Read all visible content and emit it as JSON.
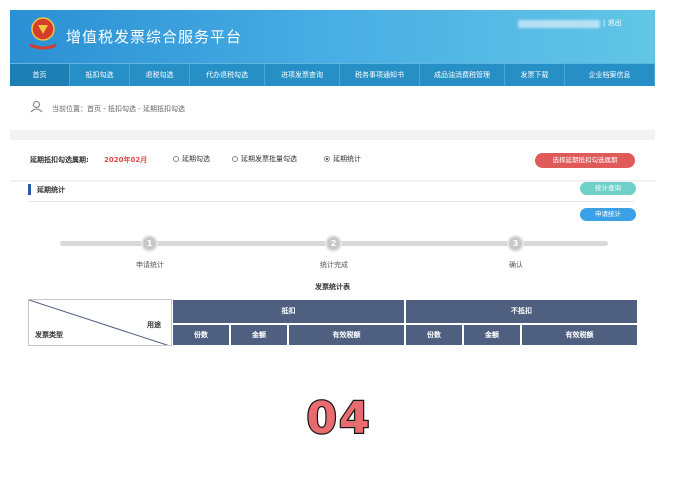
{
  "header": {
    "title": "增值税发票综合服务平台",
    "logout": "| 退出"
  },
  "nav": {
    "items": [
      {
        "label": "首页",
        "active": true
      },
      {
        "label": "抵扣勾选"
      },
      {
        "label": "退税勾选"
      },
      {
        "label": "代办退税勾选"
      },
      {
        "label": "进项发票查询"
      },
      {
        "label": "税务事项通知书"
      },
      {
        "label": "成品油消费税管理"
      },
      {
        "label": "发票下载"
      },
      {
        "label": "企业档案信息"
      }
    ]
  },
  "breadcrumb": "当前位置：首页 - 抵扣勾选 - 延期抵扣勾选",
  "filter": {
    "period_label": "延期抵扣勾选属期:",
    "period_value": "2020年02月",
    "options": [
      {
        "label": "延期勾选",
        "checked": false
      },
      {
        "label": "延期发票批量勾选",
        "checked": false
      },
      {
        "label": "延期统计",
        "checked": true
      }
    ],
    "select_period_button": "选择延期抵扣勾选属期"
  },
  "section": {
    "title": "延期统计",
    "stats_query_button": "统计查询",
    "apply_stats_button": "申请统计"
  },
  "steps": [
    {
      "number": "1",
      "label": "申请统计"
    },
    {
      "number": "2",
      "label": "统计完成"
    },
    {
      "number": "3",
      "label": "确认"
    }
  ],
  "table": {
    "title": "发票统计表",
    "corner_type": "发票类型",
    "corner_use": "用途",
    "groups": [
      "抵扣",
      "不抵扣"
    ],
    "columns": [
      "份数",
      "金额",
      "有效税额",
      "份数",
      "金额",
      "有效税额"
    ]
  },
  "overlay_number": "04",
  "colors": {
    "header_start": "#2a90d3",
    "header_end": "#62c6e6",
    "nav": "#268fc6",
    "accent_red": "#e05a5a",
    "table_header": "#4e5f7f",
    "overlay_number": "#e96a6f"
  }
}
